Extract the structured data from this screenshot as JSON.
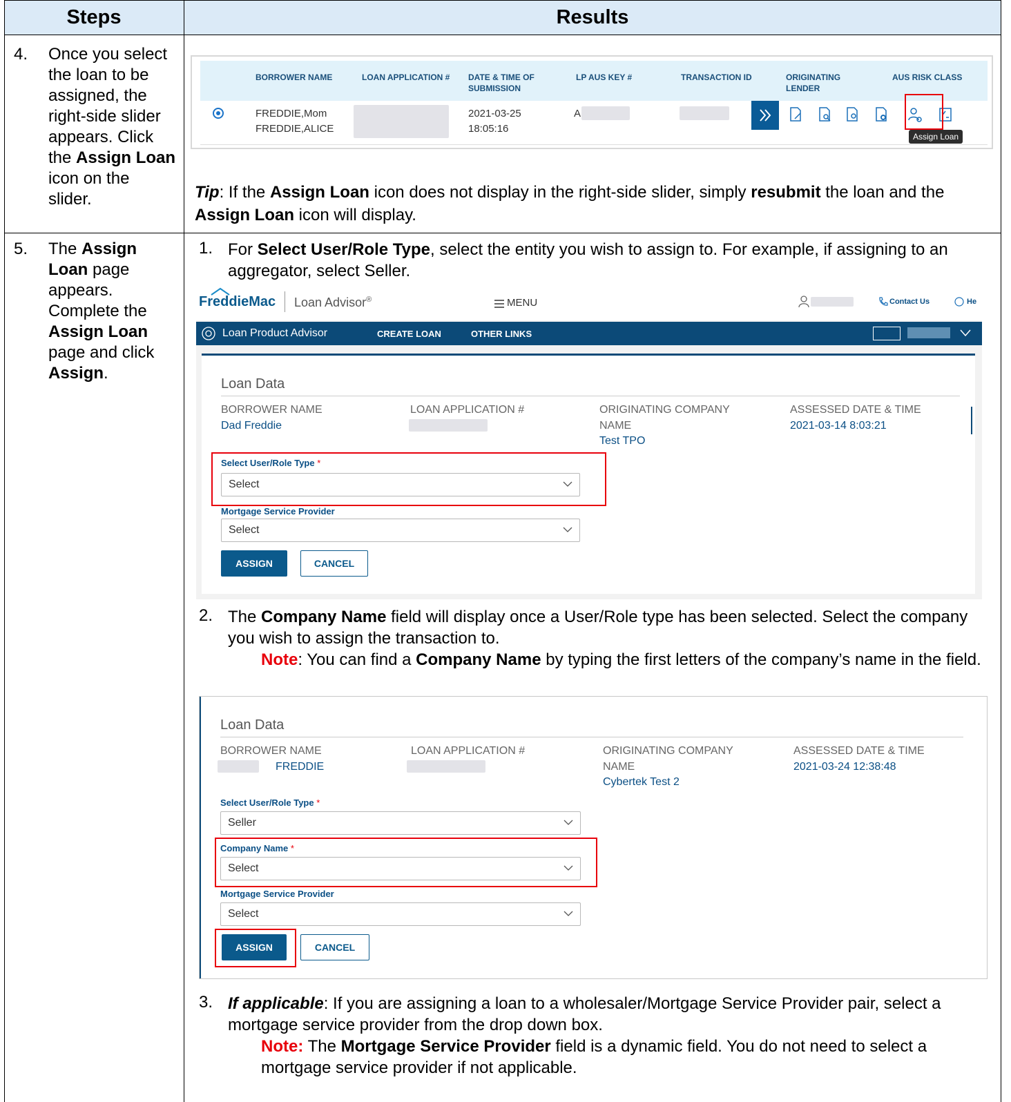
{
  "table": {
    "header_steps": "Steps",
    "header_results": "Results"
  },
  "step4": {
    "number": "4.",
    "text_a": "Once you select the loan to be assigned, the right-side slider appears. Click the ",
    "bold_a": "Assign Loan",
    "text_b": " icon on the slider."
  },
  "step5": {
    "number": "5.",
    "text_a": "The ",
    "bold_a": "Assign Loan",
    "text_b": " page appears. Complete the ",
    "bold_b": "Assign Loan",
    "text_c": " page and click ",
    "bold_c": "Assign",
    "text_d": "."
  },
  "grid": {
    "columns": [
      "BORROWER NAME",
      "LOAN APPLICATION #",
      "DATE & TIME OF SUBMISSION",
      "LP AUS KEY #",
      "TRANSACTION ID",
      "ORIGINATING LENDER",
      "AUS RISK CLASS"
    ],
    "row": {
      "borrower_1": "FREDDIE,Mom",
      "borrower_2": "FREDDIE,ALICE",
      "date": "2021-03-25",
      "time": "18:05:16",
      "key_prefix": "A"
    },
    "slider_icons": [
      "expand-slider-icon",
      "edit-document-icon",
      "search-document-icon",
      "certificate-document-icon",
      "settings-document-icon",
      "assign-loan-icon",
      "checklist-icon"
    ],
    "tooltip": "Assign Loan"
  },
  "tip": {
    "label": "Tip",
    "text_a": ": If the ",
    "bold_a": "Assign Loan",
    "text_b": " icon does not display in the right-side slider, simply ",
    "bold_b": "resubmit",
    "text_c": " the loan and the ",
    "bold_c": "Assign Loan",
    "text_d": " icon will display."
  },
  "item1": {
    "number": "1.",
    "text_a": "For ",
    "bold_a": "Select User/Role Type",
    "text_b": ", select the entity you wish to assign to. For example, if assigning to an aggregator, select Seller."
  },
  "app": {
    "brand": "FreddieMac",
    "product": "Loan Advisor",
    "product_mark": "®",
    "menu": "MENU",
    "contact": "Contact Us",
    "help": "He",
    "nav_title": "Loan Product Advisor",
    "nav_create": "CREATE LOAN",
    "nav_other": "OTHER LINKS"
  },
  "form1": {
    "section": "Loan Data",
    "col1_label": "BORROWER NAME",
    "col1_value": "Dad Freddie",
    "col2_label": "LOAN APPLICATION #",
    "col3_label": "ORIGINATING COMPANY",
    "col3_label2": "NAME",
    "col3_value": "Test TPO",
    "col4_label": "ASSESSED DATE & TIME",
    "col4_value": "2021-03-14 8:03:21",
    "role_label": "Select User/Role Type",
    "role_value": "Select",
    "msp_label": "Mortgage Service Provider",
    "msp_value": "Select",
    "assign": "ASSIGN",
    "cancel": "CANCEL"
  },
  "item2": {
    "number": "2.",
    "text_a": "The ",
    "bold_a": "Company Name",
    "text_b": " field will display once a User/Role type has been selected. Select the company you wish to assign the transaction to.",
    "note_label": "Note",
    "note_a": ": You can find a ",
    "note_bold": "Company Name",
    "note_b": " by typing the first letters of the company’s name in the field."
  },
  "form2": {
    "section": "Loan Data",
    "col1_label": "BORROWER NAME",
    "col1_value": "FREDDIE",
    "col2_label": "LOAN APPLICATION #",
    "col3_label": "ORIGINATING COMPANY",
    "col3_label2": "NAME",
    "col3_value": "Cybertek Test 2",
    "col4_label": "ASSESSED DATE & TIME",
    "col4_value": "2021-03-24 12:38:48",
    "role_label": "Select User/Role Type",
    "role_value": "Seller",
    "company_label": "Company Name",
    "company_value": "Select",
    "msp_label": "Mortgage Service Provider",
    "msp_value": "Select",
    "assign": "ASSIGN",
    "cancel": "CANCEL"
  },
  "item3": {
    "number": "3.",
    "lead": "If applicable",
    "text_a": ": If you are assigning a loan to a wholesaler/Mortgage Service Provider pair, select a mortgage service provider from the drop down box.",
    "note_label": "Note:",
    "note_a": " The ",
    "note_bold": "Mortgage Service Provider",
    "note_b": " field is a dynamic field. You do not need to select a mortgage service provider if not applicable."
  },
  "colors": {
    "header_bg": "#dbeaf7",
    "grid_header_bg": "#e1f2fa",
    "nav_bg": "#0c4a78",
    "primary_button": "#0b5a8c",
    "highlight_red": "#e8000b"
  }
}
